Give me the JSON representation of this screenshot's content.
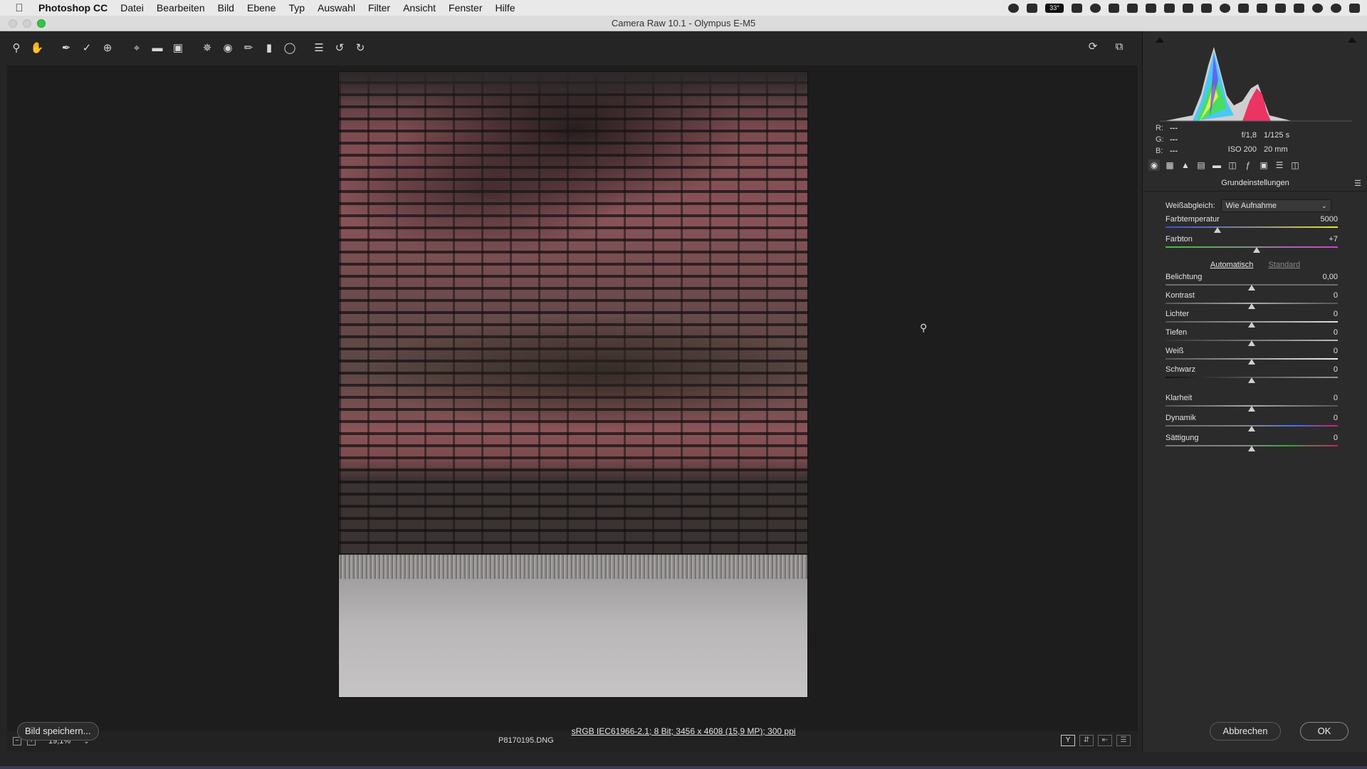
{
  "menubar": {
    "app_name": "Photoshop CC",
    "items": [
      "Datei",
      "Bearbeiten",
      "Bild",
      "Ebene",
      "Typ",
      "Auswahl",
      "Filter",
      "Ansicht",
      "Fenster",
      "Hilfe"
    ],
    "temperature": "33°"
  },
  "window": {
    "title": "Camera Raw 10.1 - Olympus E-M5"
  },
  "toolbar": {
    "tools": [
      "zoom-icon",
      "hand-icon",
      "white-balance-icon",
      "color-sampler-icon",
      "targeted-adjustment-icon",
      "crop-icon",
      "straighten-icon",
      "transform-icon",
      "spot-removal-icon",
      "red-eye-icon",
      "adjustment-brush-icon",
      "graduated-filter-icon",
      "radial-filter-icon",
      "preferences-icon",
      "rotate-left-icon",
      "rotate-right-icon"
    ],
    "right_tools": [
      "sync-icon",
      "fullscreen-icon"
    ]
  },
  "canvas": {
    "zoom_level": "19,1%",
    "filename": "P8170195.DNG"
  },
  "info": {
    "r_label": "R:",
    "r_value": "---",
    "g_label": "G:",
    "g_value": "---",
    "b_label": "B:",
    "b_value": "---",
    "aperture": "f/1,8",
    "shutter": "1/125 s",
    "iso": "ISO 200",
    "focal": "20 mm"
  },
  "panel": {
    "section_title": "Grundeinstellungen",
    "wb_label": "Weißabgleich:",
    "wb_value": "Wie Aufnahme",
    "auto_label": "Automatisch",
    "default_label": "Standard",
    "sliders": [
      {
        "label": "Farbtemperatur",
        "value": "5000",
        "position": 0.3
      },
      {
        "label": "Farbton",
        "value": "+7",
        "position": 0.53
      },
      {
        "label": "Belichtung",
        "value": "0,00",
        "position": 0.5
      },
      {
        "label": "Kontrast",
        "value": "0",
        "position": 0.5
      },
      {
        "label": "Lichter",
        "value": "0",
        "position": 0.5
      },
      {
        "label": "Tiefen",
        "value": "0",
        "position": 0.5
      },
      {
        "label": "Weiß",
        "value": "0",
        "position": 0.5
      },
      {
        "label": "Schwarz",
        "value": "0",
        "position": 0.5
      },
      {
        "label": "Klarheit",
        "value": "0",
        "position": 0.5
      },
      {
        "label": "Dynamik",
        "value": "0",
        "position": 0.5
      },
      {
        "label": "Sättigung",
        "value": "0",
        "position": 0.5
      }
    ]
  },
  "footer": {
    "save_label": "Bild speichern...",
    "workflow_label": "sRGB IEC61966-2.1; 8 Bit; 3456 x 4608 (15,9 MP); 300 ppi",
    "cancel_label": "Abbrechen",
    "ok_label": "OK"
  },
  "colors": {
    "accent": "#36c347",
    "panel_bg": "#2b2b2b",
    "canvas_bg": "#1d1d1d"
  }
}
